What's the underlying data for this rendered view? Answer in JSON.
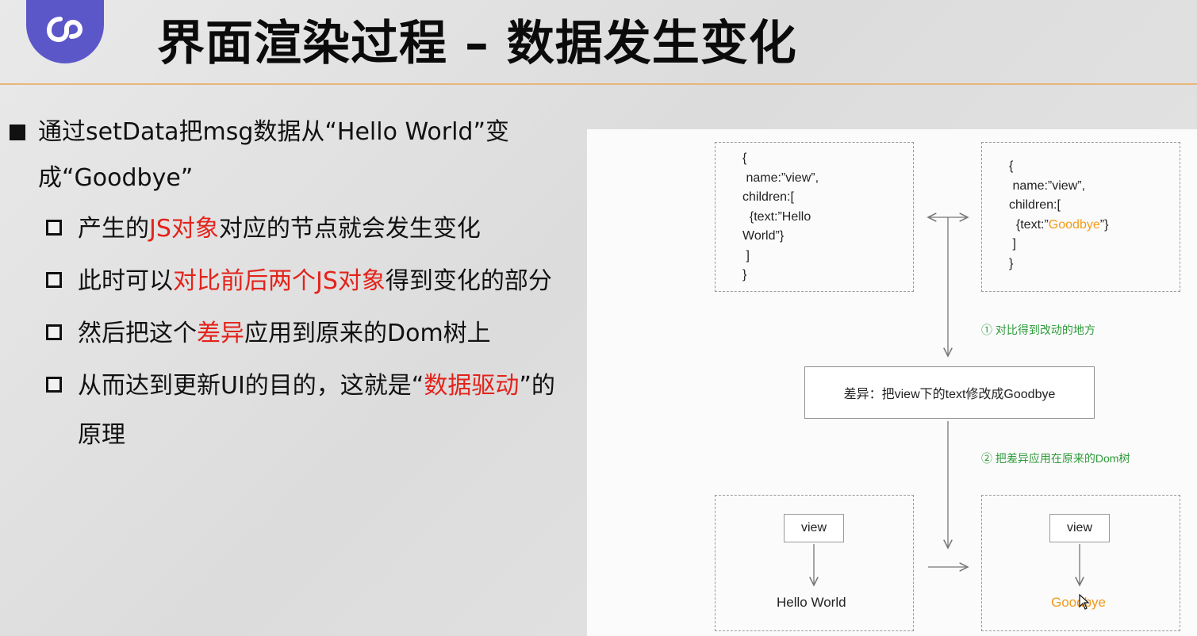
{
  "header": {
    "title": "界面渲染过程 – 数据发生变化",
    "logo_icon": "mini-program-logo-icon",
    "accent_color": "#5b57c9"
  },
  "bullets": {
    "main": "通过setData把msg数据从“Hello World”变成“Goodbye”",
    "s1_a": "产生的",
    "s1_red": "JS对象",
    "s1_b": "对应的节点就会发生变化",
    "s2_a": "此时可以",
    "s2_red": "对比前后两个JS对象",
    "s2_b": "得到变化的部分",
    "s3_a": "然后把这个",
    "s3_red": "差异",
    "s3_b": "应用到原来的Dom树上",
    "s4_a": "从而达到更新UI的目的，这就是“",
    "s4_red": "数据驱动",
    "s4_b": "”的原理",
    "highlight_color": "#e3231b"
  },
  "diagram": {
    "left_code": {
      "l1": "{",
      "l2": " name:”view”,",
      "l3": "children:[",
      "l4": "  {text:”Hello",
      "l5": "World”}",
      "l6": " ]",
      "l7": "}"
    },
    "right_code": {
      "l1": "{",
      "l2": " name:”view”,",
      "l3": "children:[",
      "l4a": "  {text:”",
      "l4b": "Goodbye",
      "l4c": "”}",
      "l5": " ]",
      "l6": "}"
    },
    "step1": "① 对比得到改动的地方",
    "diff": "差异：把view下的text修改成Goodbye",
    "step2": "② 把差异应用在原来的Dom树",
    "left_tree": {
      "node": "view",
      "leaf": "Hello World"
    },
    "right_tree": {
      "node": "view",
      "leaf": "Goodbye"
    },
    "step_color": "#2e9a3a",
    "changed_color": "#f19a1a"
  }
}
